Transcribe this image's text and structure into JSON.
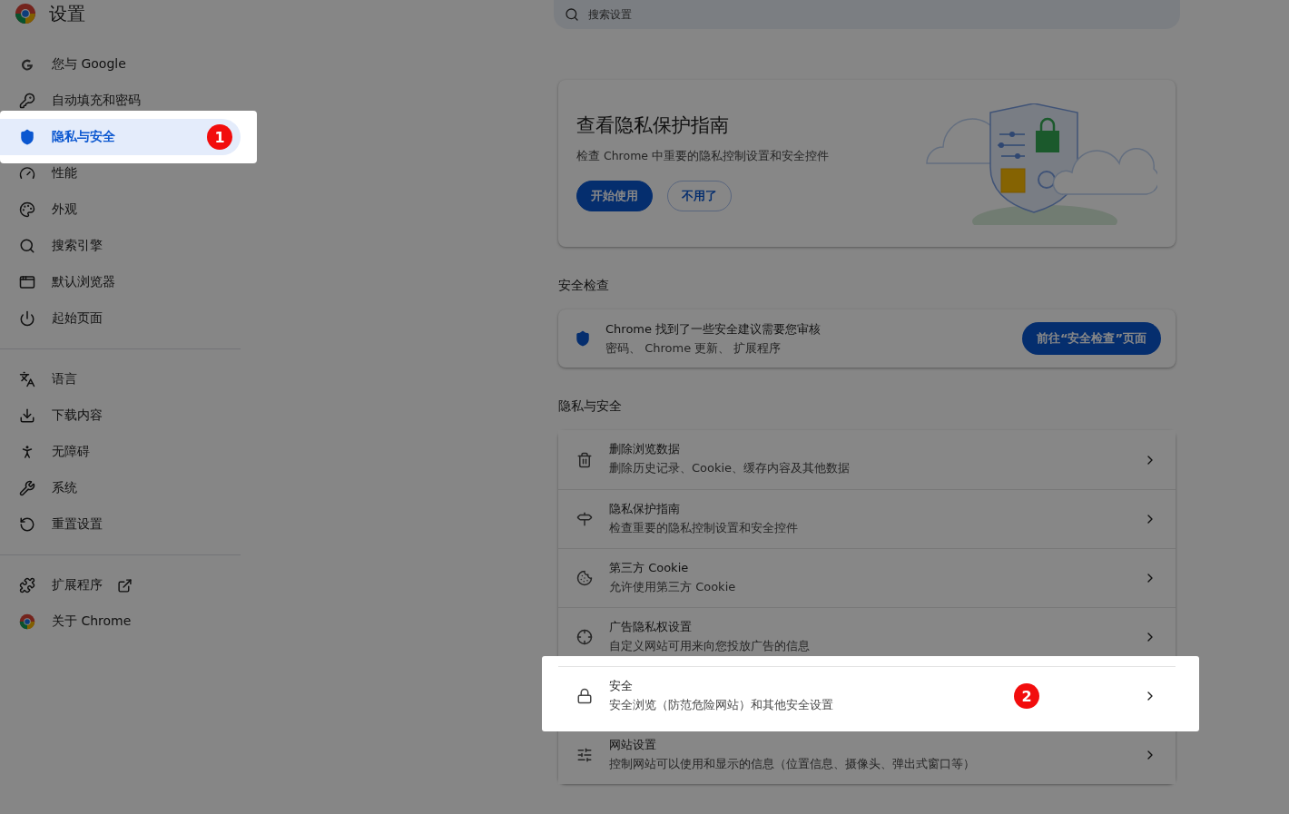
{
  "header": {
    "title": "设置",
    "search": {
      "placeholder": "搜索设置"
    }
  },
  "sidebar": {
    "groups": [
      {
        "items": [
          {
            "label": "您与 Google",
            "selected": false,
            "spotlight": false,
            "external": false
          },
          {
            "label": "自动填充和密码",
            "selected": false,
            "spotlight": false,
            "external": false
          },
          {
            "label": "隐私与安全",
            "selected": true,
            "spotlight": true,
            "external": false,
            "badge": "1"
          },
          {
            "label": "性能",
            "selected": false,
            "spotlight": false,
            "external": false
          },
          {
            "label": "外观",
            "selected": false,
            "spotlight": false,
            "external": false
          },
          {
            "label": "搜索引擎",
            "selected": false,
            "spotlight": false,
            "external": false
          },
          {
            "label": "默认浏览器",
            "selected": false,
            "spotlight": false,
            "external": false
          },
          {
            "label": "起始页面",
            "selected": false,
            "spotlight": false,
            "external": false
          }
        ]
      },
      {
        "items": [
          {
            "label": "语言",
            "selected": false,
            "spotlight": false,
            "external": false
          },
          {
            "label": "下载内容",
            "selected": false,
            "spotlight": false,
            "external": false
          },
          {
            "label": "无障碍",
            "selected": false,
            "spotlight": false,
            "external": false
          },
          {
            "label": "系统",
            "selected": false,
            "spotlight": false,
            "external": false
          },
          {
            "label": "重置设置",
            "selected": false,
            "spotlight": false,
            "external": false
          }
        ]
      },
      {
        "items": [
          {
            "label": "扩展程序",
            "selected": false,
            "spotlight": false,
            "external": true
          },
          {
            "label": "关于 Chrome",
            "selected": false,
            "spotlight": false,
            "external": false
          }
        ]
      }
    ]
  },
  "privacy_guide_card": {
    "title": "查看隐私保护指南",
    "description": "检查 Chrome 中重要的隐私控制设置和安全控件",
    "buttons": [
      {
        "label": "开始使用",
        "kind": "primary"
      },
      {
        "label": "不用了",
        "kind": "outline"
      }
    ]
  },
  "safety_check": {
    "heading": "安全检查",
    "title": "Chrome 找到了一些安全建议需要您审核",
    "description": "密码、 Chrome 更新、 扩展程序",
    "button": "前往“安全检查”页面"
  },
  "privacy_security": {
    "heading": "隐私与安全",
    "rows": [
      {
        "title": "删除浏览数据",
        "subtitle": "删除历史记录、Cookie、缓存内容及其他数据",
        "spotlight": false
      },
      {
        "title": "隐私保护指南",
        "subtitle": "检查重要的隐私控制设置和安全控件",
        "spotlight": false
      },
      {
        "title": "第三方 Cookie",
        "subtitle": "允许使用第三方 Cookie",
        "spotlight": false
      },
      {
        "title": "广告隐私权设置",
        "subtitle": "自定义网站可用来向您投放广告的信息",
        "spotlight": false
      },
      {
        "title": "安全",
        "subtitle": "安全浏览（防范危险网站）和其他安全设置",
        "spotlight": true,
        "badge": "2"
      },
      {
        "title": "网站设置",
        "subtitle": "控制网站可以使用和显示的信息（位置信息、摄像头、弹出式窗口等）",
        "spotlight": false
      }
    ]
  }
}
